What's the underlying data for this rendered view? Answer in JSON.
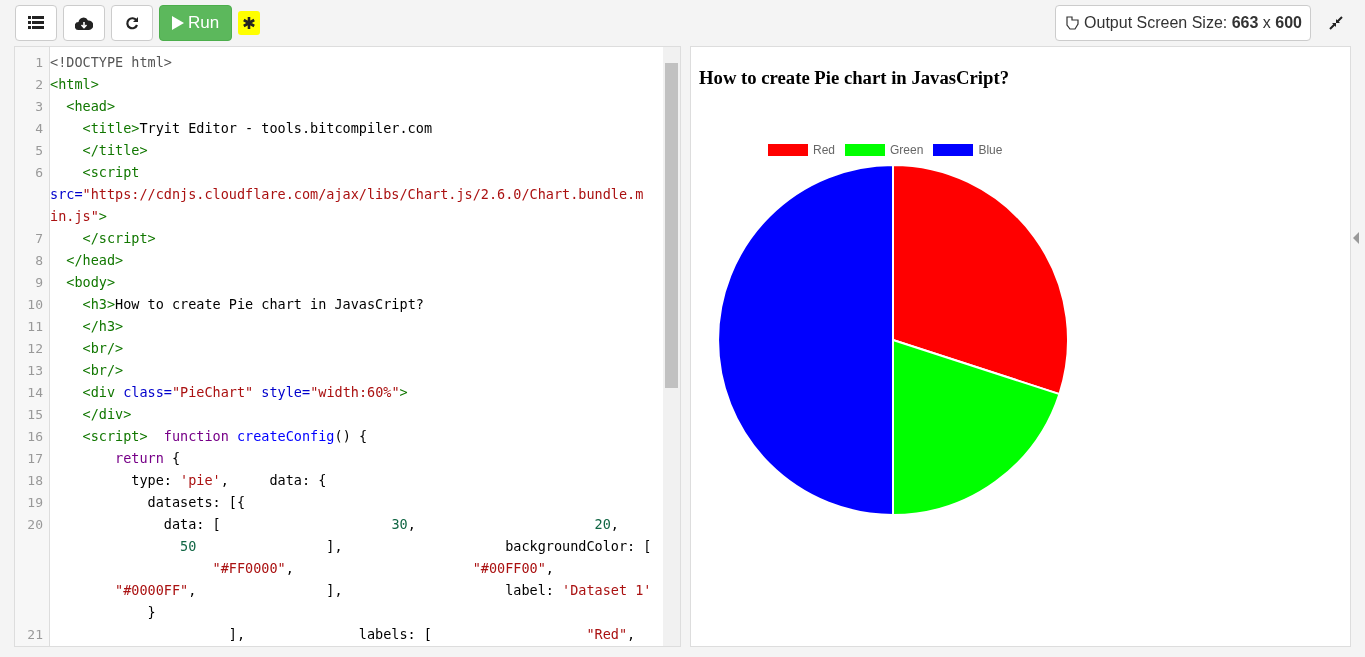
{
  "toolbar": {
    "buttons": [
      {
        "kind": "list"
      },
      {
        "kind": "download"
      },
      {
        "kind": "reload"
      }
    ],
    "run_button": {
      "label": "Run"
    },
    "settings_badge": {
      "kind": "asterisk"
    },
    "output_size": {
      "label": "Output Screen Size: **663** x **600**"
    }
  },
  "editor": {
    "lines": [
      {
        "number": "1",
        "tokens": [
          {
            "kind": "meta",
            "text": "<!DOCTYPE html>"
          }
        ]
      },
      {
        "number": "2",
        "tokens": [
          {
            "kind": "tag",
            "text": "<html>"
          }
        ]
      },
      {
        "number": "3",
        "tokens": [
          {
            "kind": "tag",
            "text": "  <head>"
          }
        ]
      },
      {
        "number": "4",
        "tokens": [
          {
            "kind": "tag",
            "text": "    <title>"
          },
          {
            "kind": "plain",
            "text": "Tryit Editor - tools.bitcompiler.com"
          }
        ]
      },
      {
        "number": "5",
        "tokens": [
          {
            "kind": "tag",
            "text": "    </title>"
          }
        ]
      },
      {
        "number": "6",
        "tokens": [
          {
            "kind": "tag",
            "text": "    <script"
          }
        ]
      },
      {
        "tokens": [
          {
            "kind": "attr",
            "text": "src="
          },
          {
            "kind": "string",
            "text": "\"https://cdnjs.cloudflare.com/ajax/libs/Chart.js/2.6.0/Chart.bundle.m"
          }
        ]
      },
      {
        "tokens": [
          {
            "kind": "string",
            "text": "in.js\""
          },
          {
            "kind": "tag",
            "text": ">"
          }
        ]
      },
      {
        "number": "7",
        "tokens": [
          {
            "kind": "tag",
            "text": "    </script>"
          }
        ]
      },
      {
        "number": "8",
        "tokens": [
          {
            "kind": "tag",
            "text": "  </head>"
          }
        ]
      },
      {
        "number": "9",
        "tokens": [
          {
            "kind": "tag",
            "text": "  <body>"
          }
        ]
      },
      {
        "number": "10",
        "tokens": [
          {
            "kind": "tag",
            "text": "    <h3>"
          },
          {
            "kind": "plain",
            "text": "How to create Pie chart in JavasCript?"
          }
        ]
      },
      {
        "number": "11",
        "tokens": [
          {
            "kind": "tag",
            "text": "    </h3>"
          }
        ]
      },
      {
        "number": "12",
        "tokens": [
          {
            "kind": "tag",
            "text": "    <br/>"
          }
        ]
      },
      {
        "number": "13",
        "tokens": [
          {
            "kind": "tag",
            "text": "    <br/>"
          }
        ]
      },
      {
        "number": "14",
        "tokens": [
          {
            "kind": "tag",
            "text": "    <div"
          },
          {
            "kind": "attr",
            "text": " class="
          },
          {
            "kind": "string",
            "text": "\"PieChart\""
          },
          {
            "kind": "attr",
            "text": " style="
          },
          {
            "kind": "string",
            "text": "\"width:60%\""
          },
          {
            "kind": "tag",
            "text": ">"
          }
        ]
      },
      {
        "number": "15",
        "tokens": [
          {
            "kind": "tag",
            "text": "    </div>"
          }
        ]
      },
      {
        "number": "16",
        "tokens": [
          {
            "kind": "tag",
            "text": "    <script>"
          },
          {
            "kind": "keyword",
            "text": "  function"
          },
          {
            "kind": "def",
            "text": " createConfig"
          },
          {
            "kind": "plain",
            "text": "() {"
          }
        ]
      },
      {
        "number": "17",
        "tokens": [
          {
            "kind": "keyword",
            "text": "        return"
          },
          {
            "kind": "plain",
            "text": " {"
          }
        ]
      },
      {
        "number": "18",
        "tokens": [
          {
            "kind": "plain",
            "text": "          type: "
          },
          {
            "kind": "string",
            "text": "'pie'"
          },
          {
            "kind": "plain",
            "text": ",     data: {"
          }
        ]
      },
      {
        "number": "19",
        "tokens": [
          {
            "kind": "plain",
            "text": "            datasets: [{"
          }
        ]
      },
      {
        "number": "20",
        "tokens": [
          {
            "kind": "plain",
            "text": "              data: [                     "
          },
          {
            "kind": "number",
            "text": "30"
          },
          {
            "kind": "plain",
            "text": ",                      "
          },
          {
            "kind": "number",
            "text": "20"
          },
          {
            "kind": "plain",
            "text": ","
          }
        ]
      },
      {
        "tokens": [
          {
            "kind": "number",
            "text": "                50"
          },
          {
            "kind": "plain",
            "text": "                ],                    backgroundColor: ["
          }
        ]
      },
      {
        "tokens": [
          {
            "kind": "string",
            "text": "                    \"#FF0000\""
          },
          {
            "kind": "plain",
            "text": ",                      "
          },
          {
            "kind": "string",
            "text": "\"#00FF00\""
          },
          {
            "kind": "plain",
            "text": ","
          }
        ]
      },
      {
        "tokens": [
          {
            "kind": "string",
            "text": "        \"#0000FF\""
          },
          {
            "kind": "plain",
            "text": ",                ],                    label: "
          },
          {
            "kind": "string",
            "text": "'Dataset 1'"
          }
        ]
      },
      {
        "tokens": [
          {
            "kind": "plain",
            "text": "            }"
          }
        ]
      },
      {
        "number": "21",
        "tokens": [
          {
            "kind": "plain",
            "text": "                      ],              labels: [                   "
          },
          {
            "kind": "string",
            "text": "\"Red\""
          },
          {
            "kind": "plain",
            "text": ","
          }
        ]
      }
    ]
  },
  "output": {
    "heading": "How to create Pie chart in JavasCript?",
    "chart_data": {
      "type": "pie",
      "categories": [
        "Red",
        "Green",
        "Blue"
      ],
      "series": [
        {
          "values": [
            30,
            20,
            50
          ]
        }
      ],
      "legend": true,
      "colors": [
        "#ff0000",
        "#00ff00",
        "#0000ff"
      ]
    }
  }
}
